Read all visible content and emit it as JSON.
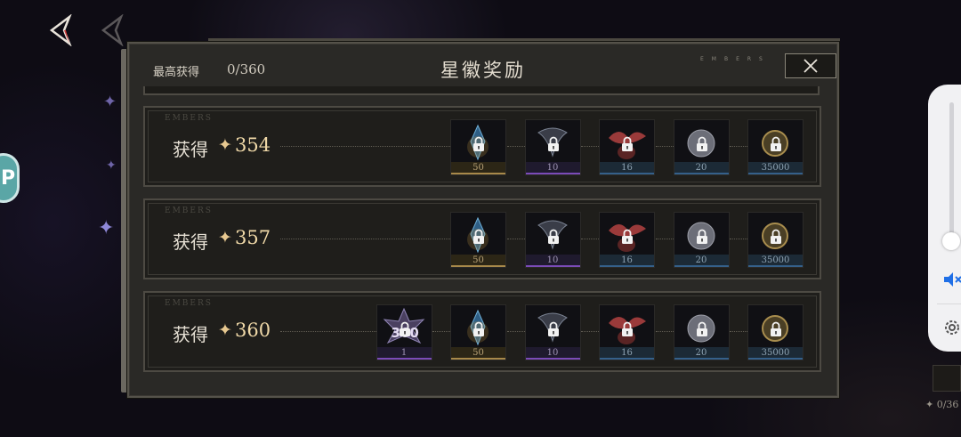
{
  "header": {
    "best_label": "最高获得",
    "best_value": "0/360",
    "title": "星徽奖励",
    "deco": "EMBERS"
  },
  "rows": [
    {
      "tag": "EMBERS",
      "label": "获得",
      "star": "✦",
      "value": "354",
      "rewards": [
        {
          "icon": "blue-crystal-icon",
          "count": "50",
          "style": "gold"
        },
        {
          "icon": "dark-feather-icon",
          "count": "10",
          "style": "purple"
        },
        {
          "icon": "red-leaf-icon",
          "count": "16",
          "style": "blue"
        },
        {
          "icon": "silver-orb-icon",
          "count": "20",
          "style": "blue"
        },
        {
          "icon": "gold-coin-icon",
          "count": "35000",
          "style": "blue"
        }
      ]
    },
    {
      "tag": "EMBERS",
      "label": "获得",
      "star": "✦",
      "value": "357",
      "rewards": [
        {
          "icon": "blue-crystal-icon",
          "count": "50",
          "style": "gold"
        },
        {
          "icon": "dark-feather-icon",
          "count": "10",
          "style": "purple"
        },
        {
          "icon": "red-leaf-icon",
          "count": "16",
          "style": "blue"
        },
        {
          "icon": "silver-orb-icon",
          "count": "20",
          "style": "blue"
        },
        {
          "icon": "gold-coin-icon",
          "count": "35000",
          "style": "blue"
        }
      ]
    },
    {
      "tag": "EMBERS",
      "label": "获得",
      "star": "✦",
      "value": "360",
      "rewards": [
        {
          "icon": "star-badge-icon",
          "count": "1",
          "style": "purple",
          "badge": "360"
        },
        {
          "icon": "blue-crystal-icon",
          "count": "50",
          "style": "gold"
        },
        {
          "icon": "dark-feather-icon",
          "count": "10",
          "style": "purple"
        },
        {
          "icon": "red-leaf-icon",
          "count": "16",
          "style": "blue"
        },
        {
          "icon": "silver-orb-icon",
          "count": "20",
          "style": "blue"
        },
        {
          "icon": "gold-coin-icon",
          "count": "35000",
          "style": "blue"
        }
      ]
    }
  ],
  "corner": {
    "progress": "✦ 0/36"
  },
  "colors": {
    "accent_gold": "#f0d9a8",
    "mute_blue": "#1f6fe6"
  }
}
